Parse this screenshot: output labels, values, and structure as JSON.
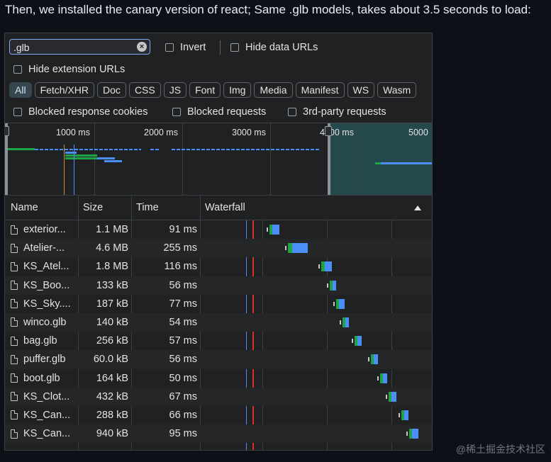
{
  "caption": "Then, we installed the canary version of react; Same .glb models, takes about 3.5 seconds to load:",
  "watermark": "@稀土掘金技术社区",
  "filter": {
    "search_value": ".glb",
    "invert_label": "Invert",
    "hide_data_urls_label": "Hide data URLs",
    "hide_extension_urls_label": "Hide extension URLs",
    "type_chips": [
      "All",
      "Fetch/XHR",
      "Doc",
      "CSS",
      "JS",
      "Font",
      "Img",
      "Media",
      "Manifest",
      "WS",
      "Wasm"
    ],
    "active_chip": "All",
    "blocked_cookies_label": "Blocked response cookies",
    "blocked_requests_label": "Blocked requests",
    "third_party_label": "3rd-party requests"
  },
  "overview": {
    "ticks": [
      "1000 ms",
      "2000 ms",
      "3000 ms",
      "4000 ms",
      "5000"
    ]
  },
  "table": {
    "headers": {
      "name": "Name",
      "size": "Size",
      "time": "Time",
      "waterfall": "Waterfall"
    },
    "rows": [
      {
        "name": "exterior...",
        "size": "1.1 MB",
        "time": "91 ms"
      },
      {
        "name": "Atelier-...",
        "size": "4.6 MB",
        "time": "255 ms"
      },
      {
        "name": "KS_Atel...",
        "size": "1.8 MB",
        "time": "116 ms"
      },
      {
        "name": "KS_Boo...",
        "size": "133 kB",
        "time": "56 ms"
      },
      {
        "name": "KS_Sky....",
        "size": "187 kB",
        "time": "77 ms"
      },
      {
        "name": "winco.glb",
        "size": "140 kB",
        "time": "54 ms"
      },
      {
        "name": "bag.glb",
        "size": "256 kB",
        "time": "57 ms"
      },
      {
        "name": "puffer.glb",
        "size": "60.0 kB",
        "time": "56 ms"
      },
      {
        "name": "boot.glb",
        "size": "164 kB",
        "time": "50 ms"
      },
      {
        "name": "KS_Clot...",
        "size": "432 kB",
        "time": "67 ms"
      },
      {
        "name": "KS_Can...",
        "size": "288 kB",
        "time": "66 ms"
      },
      {
        "name": "KS_Can...",
        "size": "940 kB",
        "time": "95 ms"
      }
    ]
  },
  "colors": {
    "accent": "#7cacf8",
    "download": "#4c8ef7",
    "waiting": "#1ea446",
    "load_line": "#d93025",
    "dcl_line": "#4c8ef7"
  }
}
